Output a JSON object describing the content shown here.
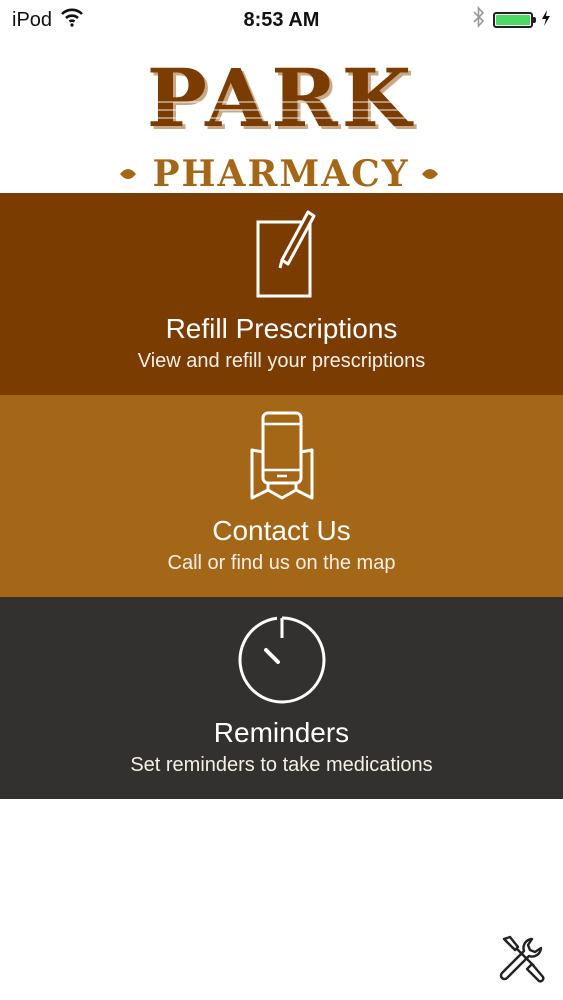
{
  "status_bar": {
    "carrier": "iPod",
    "time": "8:53 AM",
    "battery_level": 1.0,
    "battery_color": "#4cd964"
  },
  "logo": {
    "line1": "PARK",
    "line2": "PHARMACY",
    "color": "#7a3c00",
    "accent": "#a46718"
  },
  "menu": {
    "items": [
      {
        "title": "Refill Prescriptions",
        "subtitle": "View and refill your prescriptions",
        "icon": "notepad-pencil-icon",
        "color": "#7a3c00"
      },
      {
        "title": "Contact Us",
        "subtitle": "Call or find us on the map",
        "icon": "phone-map-icon",
        "color": "#a46718"
      },
      {
        "title": "Reminders",
        "subtitle": "Set reminders to take medications",
        "icon": "timer-icon",
        "color": "#333130"
      }
    ]
  },
  "footer": {
    "tools_icon": "tools-icon"
  }
}
